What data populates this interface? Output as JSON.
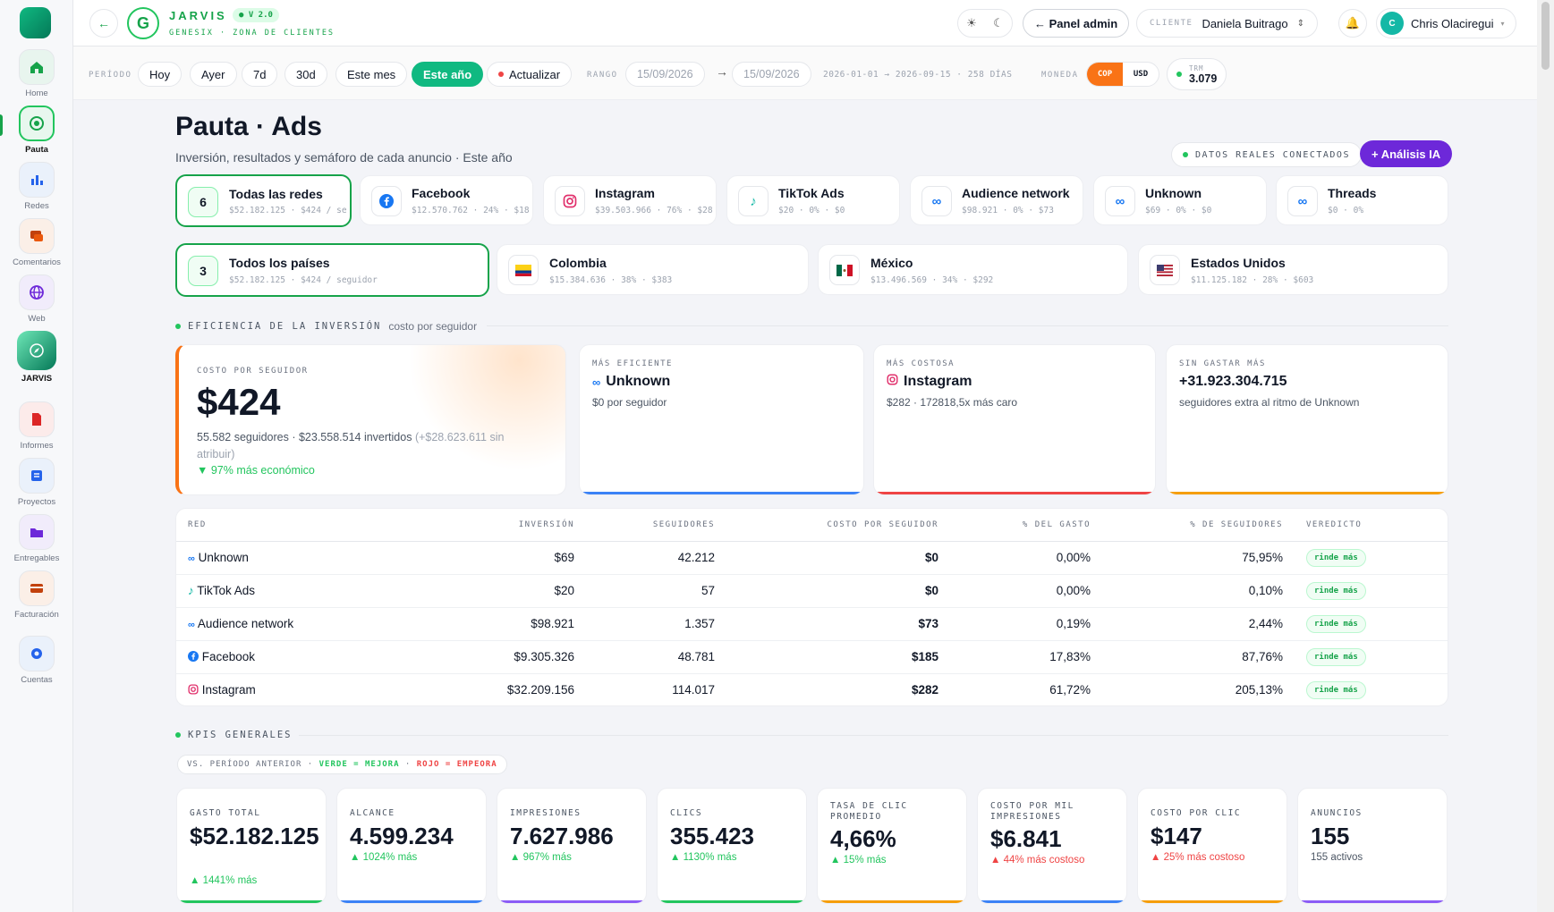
{
  "sidebar": {
    "items": [
      {
        "label": "Home",
        "icon": "home-icon"
      },
      {
        "label": "Pauta",
        "icon": "target-icon"
      },
      {
        "label": "Redes",
        "icon": "bar-chart-icon"
      },
      {
        "label": "Comentarios",
        "icon": "chat-icon"
      },
      {
        "label": "Web",
        "icon": "globe-icon"
      },
      {
        "label": "JARVIS",
        "icon": "compass-icon"
      },
      {
        "label": "Informes",
        "icon": "report-icon"
      },
      {
        "label": "Proyectos",
        "icon": "project-icon"
      },
      {
        "label": "Entregables",
        "icon": "folder-icon"
      },
      {
        "label": "Facturación",
        "icon": "card-icon"
      },
      {
        "label": "Cuentas",
        "icon": "account-icon"
      }
    ]
  },
  "header": {
    "brand_letter": "G",
    "brand_name": "JARVIS",
    "version": "● V 2.0",
    "brand_sub": "GENESIX · ZONA DE CLIENTES",
    "admin_label": "← Panel admin",
    "client_label": "CLIENTE",
    "client_value": "Daniela Buitrago",
    "user_initial": "C",
    "user_name": "Chris Olaciregui"
  },
  "filters": {
    "period_label": "PERÍODO",
    "periods": [
      "Hoy",
      "Ayer",
      "7d",
      "30d",
      "Este mes",
      "Este año"
    ],
    "refresh_label": "Actualizar",
    "range_label": "RANGO",
    "date_from": "15/09/2026",
    "date_to": "15/09/2026",
    "range_summary": "2026-01-01 → 2026-09-15 · 258 DÍAS",
    "currency_label": "MONEDA",
    "currencies": [
      "COP",
      "USD"
    ],
    "trm_label": "TRM",
    "trm_value": "3.079"
  },
  "page": {
    "title": "Pauta · Ads",
    "subtitle": "Inversión, resultados y semáforo de cada anuncio · Este año",
    "live_label": "DATOS REALES CONECTADOS",
    "ai_button": "+ Análisis IA"
  },
  "networks": [
    {
      "badge": "6",
      "name": "Todas las redes",
      "meta": "$52.182.125 · $424 / se"
    },
    {
      "name": "Facebook",
      "meta": "$12.570.762 · 24% · $18",
      "icon": "facebook-icon"
    },
    {
      "name": "Instagram",
      "meta": "$39.503.966 · 76% · $28",
      "icon": "instagram-icon"
    },
    {
      "name": "TikTok Ads",
      "meta": "$20 · 0% · $0",
      "icon": "tiktok-icon"
    },
    {
      "name": "Audience network",
      "meta": "$98.921 · 0% · $73",
      "icon": "meta-icon"
    },
    {
      "name": "Unknown",
      "meta": "$69 · 0% · $0",
      "icon": "meta-icon"
    },
    {
      "name": "Threads",
      "meta": "$0 · 0%",
      "icon": "meta-icon"
    }
  ],
  "countries": [
    {
      "badge": "3",
      "name": "Todos los países",
      "meta": "$52.182.125 · $424 / seguidor"
    },
    {
      "name": "Colombia",
      "meta": "$15.384.636 · 38% · $383",
      "flag": "colombia-flag-icon"
    },
    {
      "name": "México",
      "meta": "$13.496.569 · 34% · $292",
      "flag": "mexico-flag-icon"
    },
    {
      "name": "Estados Unidos",
      "meta": "$11.125.182 · 28% · $603",
      "flag": "usa-flag-icon"
    }
  ],
  "efficiency": {
    "section_title": "EFICIENCIA DE LA INVERSIÓN",
    "section_note": "costo por seguidor",
    "main_label": "COSTO POR SEGUIDOR",
    "main_value": "$424",
    "main_desc": "55.582 seguidores · $23.558.514 invertidos",
    "main_desc_extra": "(+$28.623.611 sin atribuir)",
    "main_delta": "▼ 97% más económico",
    "cards": [
      {
        "label": "MÁS EFICIENTE",
        "name": "Unknown",
        "desc": "$0 por seguidor",
        "color": "#3b82f6"
      },
      {
        "label": "MÁS COSTOSA",
        "name": "Instagram",
        "desc": "$282 · 172818,5x más caro",
        "color": "#ef4444"
      },
      {
        "label": "SIN GASTAR MÁS",
        "name": "+31.923.304.715",
        "desc": "seguidores extra al ritmo de Unknown",
        "color": "#f59e0b"
      }
    ]
  },
  "table": {
    "headers": [
      "RED",
      "INVERSIÓN",
      "SEGUIDORES",
      "COSTO POR SEGUIDOR",
      "% DEL GASTO",
      "% DE SEGUIDORES",
      "VEREDICTO"
    ],
    "rows": [
      [
        "Unknown",
        "$69",
        "42.212",
        "$0",
        "0,00%",
        "75,95%",
        "rinde más"
      ],
      [
        "TikTok Ads",
        "$20",
        "57",
        "$0",
        "0,00%",
        "0,10%",
        "rinde más"
      ],
      [
        "Audience network",
        "$98.921",
        "1.357",
        "$73",
        "0,19%",
        "2,44%",
        "rinde más"
      ],
      [
        "Facebook",
        "$9.305.326",
        "48.781",
        "$185",
        "17,83%",
        "87,76%",
        "rinde más"
      ],
      [
        "Instagram",
        "$32.209.156",
        "114.017",
        "$282",
        "61,72%",
        "205,13%",
        "rinde más"
      ]
    ]
  },
  "kpis": {
    "section_title": "KPIS GENERALES",
    "legend_a": "VS. PERÍODO ANTERIOR ·",
    "legend_b": "VERDE = MEJORA",
    "legend_c": "·",
    "legend_d": "ROJO = EMPEORA",
    "cards": [
      {
        "label": "GASTO TOTAL",
        "value": "$52.182.125",
        "delta": "▲ 1441% más",
        "tone": "good",
        "color": "#22c55e"
      },
      {
        "label": "ALCANCE",
        "value": "4.599.234",
        "delta": "▲ 1024% más",
        "tone": "good",
        "color": "#3b82f6"
      },
      {
        "label": "IMPRESIONES",
        "value": "7.627.986",
        "delta": "▲ 967% más",
        "tone": "good",
        "color": "#8b5cf6"
      },
      {
        "label": "CLICS",
        "value": "355.423",
        "delta": "▲ 1130% más",
        "tone": "good",
        "color": "#22c55e"
      },
      {
        "label": "TASA DE CLIC PROMEDIO",
        "value": "4,66%",
        "delta": "▲ 15% más",
        "tone": "good",
        "color": "#f59e0b"
      },
      {
        "label": "COSTO POR MIL IMPRESIONES",
        "value": "$6.841",
        "delta": "▲ 44% más costoso",
        "tone": "bad",
        "color": "#3b82f6"
      },
      {
        "label": "COSTO POR CLIC",
        "value": "$147",
        "delta": "▲ 25% más costoso",
        "tone": "bad",
        "color": "#f59e0b"
      },
      {
        "label": "ANUNCIOS",
        "value": "155",
        "delta": "155 activos",
        "tone": "neutral",
        "color": "#8b5cf6"
      }
    ]
  }
}
